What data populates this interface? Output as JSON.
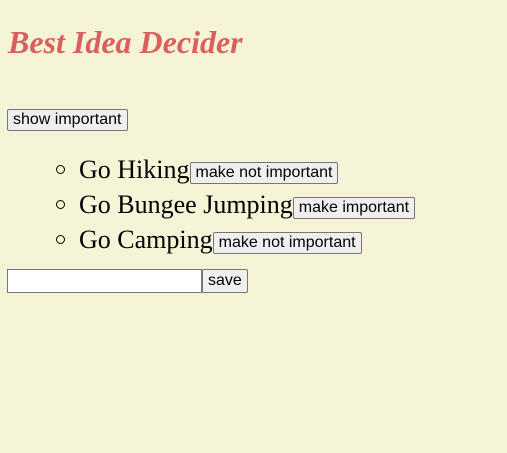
{
  "header": {
    "title": "Best Idea Decider"
  },
  "toolbar": {
    "show_important_label": "show important"
  },
  "ideas": [
    {
      "text": "Go Hiking",
      "button_label": "make not important"
    },
    {
      "text": "Go Bungee Jumping",
      "button_label": "make important"
    },
    {
      "text": "Go Camping",
      "button_label": "make not important"
    }
  ],
  "form": {
    "input_value": "",
    "save_label": "save"
  },
  "colors": {
    "background": "#f5f4d6",
    "title": "#d9605f"
  }
}
